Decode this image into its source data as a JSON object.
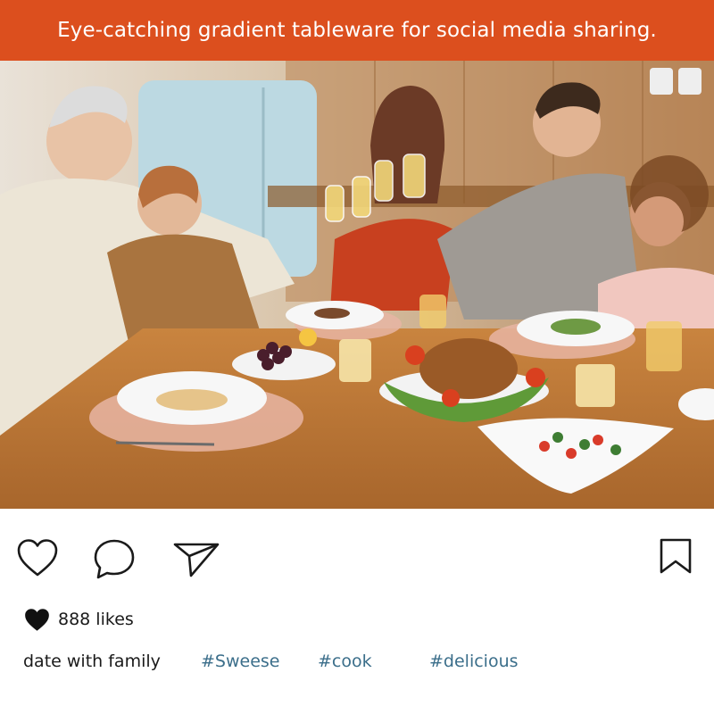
{
  "banner": {
    "text": "Eye-catching gradient tableware for social media sharing.",
    "color": "#dc4f1e"
  },
  "post": {
    "image_alt": "family toasting at dining table",
    "actions": {
      "like": "heart-icon",
      "comment": "comment-bubble-icon",
      "share": "send-icon",
      "save": "bookmark-icon"
    },
    "likes_text": "888 likes",
    "caption_text": "date with family",
    "hashtags": [
      "#Sweese",
      "#cook",
      "#delicious"
    ],
    "hashtag_color": "#3b6e8a"
  }
}
